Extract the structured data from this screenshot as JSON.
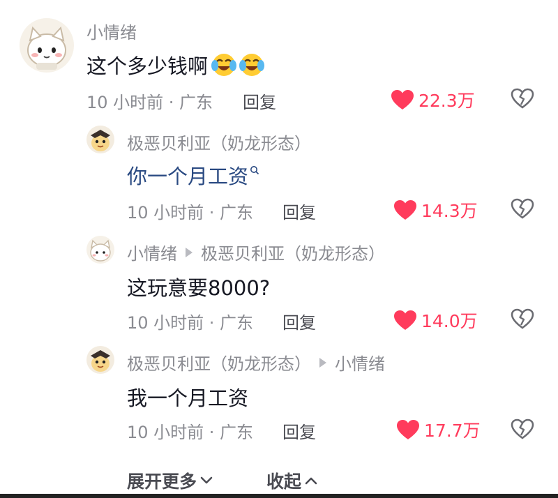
{
  "comments": [
    {
      "author": "小情绪",
      "content": "这个多少钱啊",
      "emojis": [
        "laughing-crying-icon",
        "laughing-crying-icon"
      ],
      "meta": "10 小时前 · 广东",
      "reply": "回复",
      "likes": "22.3万"
    },
    {
      "author": "极恶贝利亚（奶龙形态）",
      "content": "你一个月工资",
      "meta": "10 小时前 · 广东",
      "reply": "回复",
      "likes": "14.3万"
    },
    {
      "author": "小情绪",
      "reply_to": "极恶贝利亚（奶龙形态）",
      "content": "这玩意要8000?",
      "meta": "10 小时前 · 广东",
      "reply": "回复",
      "likes": "14.0万"
    },
    {
      "author": "极恶贝利亚（奶龙形态）",
      "reply_to": "小情绪",
      "content": "我一个月工资",
      "meta": "10 小时前 · 广东",
      "reply": "回复",
      "likes": "17.7万"
    }
  ],
  "footer": {
    "expand_label": "展开更多",
    "collapse_label": "收起"
  },
  "colors": {
    "like": "#ff3b5c",
    "meta": "#8a8b91",
    "link": "#2a4a82"
  }
}
